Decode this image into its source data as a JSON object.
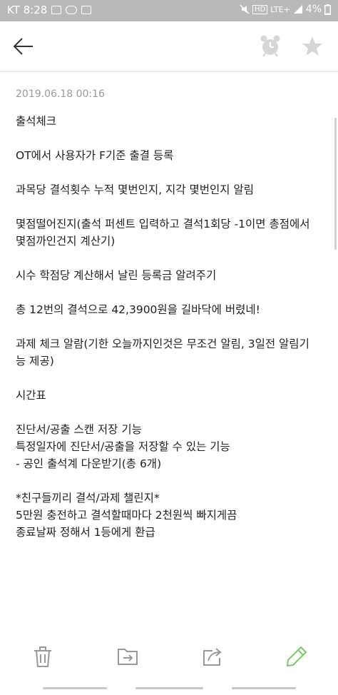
{
  "status_bar": {
    "carrier_time": "KT 8:28",
    "network": "LTE+",
    "battery": "4%"
  },
  "note": {
    "timestamp": "2019.06.18 00:16",
    "lines": [
      "출석체크",
      "",
      "OT에서 사용자가 F기준 출결 등록",
      "",
      "과목당 결석횟수 누적 몇번인지, 지각 몇번인지 알림",
      "",
      "몇점떨어진지(출석 퍼센트 입력하고 결석1회당 -1이면 총점에서",
      "몇점까인건지 계산기)",
      "",
      "시수 학점당 계산해서 날린 등록금 알려주기",
      "",
      "총 12번의 결석으로 42,3900원을 길바닥에 버렸네!",
      "",
      "과제 체크 알람(기한 오늘까지인것은 무조건 알림, 3일전 알림기",
      "능 제공)",
      "",
      "시간표",
      "",
      "진단서/공출 스캔 저장 기능",
      "특정일자에 진단서/공출을 저장할 수 있는 기능",
      "- 공인 출석계 다운받기(총 6개)",
      "",
      "*친구들끼리 결석/과제 챌린지*",
      "5만원 충전하고 결석할때마다 2천원씩 빠지게끔",
      "종료날짜 정해서 1등에게 환급"
    ]
  },
  "icons": {
    "back": "arrow-left-icon",
    "alarm": "alarm-clock-icon",
    "star": "star-icon",
    "delete": "trash-icon",
    "move": "folder-move-icon",
    "share": "share-icon",
    "edit": "pencil-icon"
  },
  "colors": {
    "status_bar": "#b9b9b9",
    "icon_gray": "#9a9a9a",
    "edit_green": "#7ec96b",
    "text": "#222222",
    "timestamp": "#9a9a9a"
  }
}
